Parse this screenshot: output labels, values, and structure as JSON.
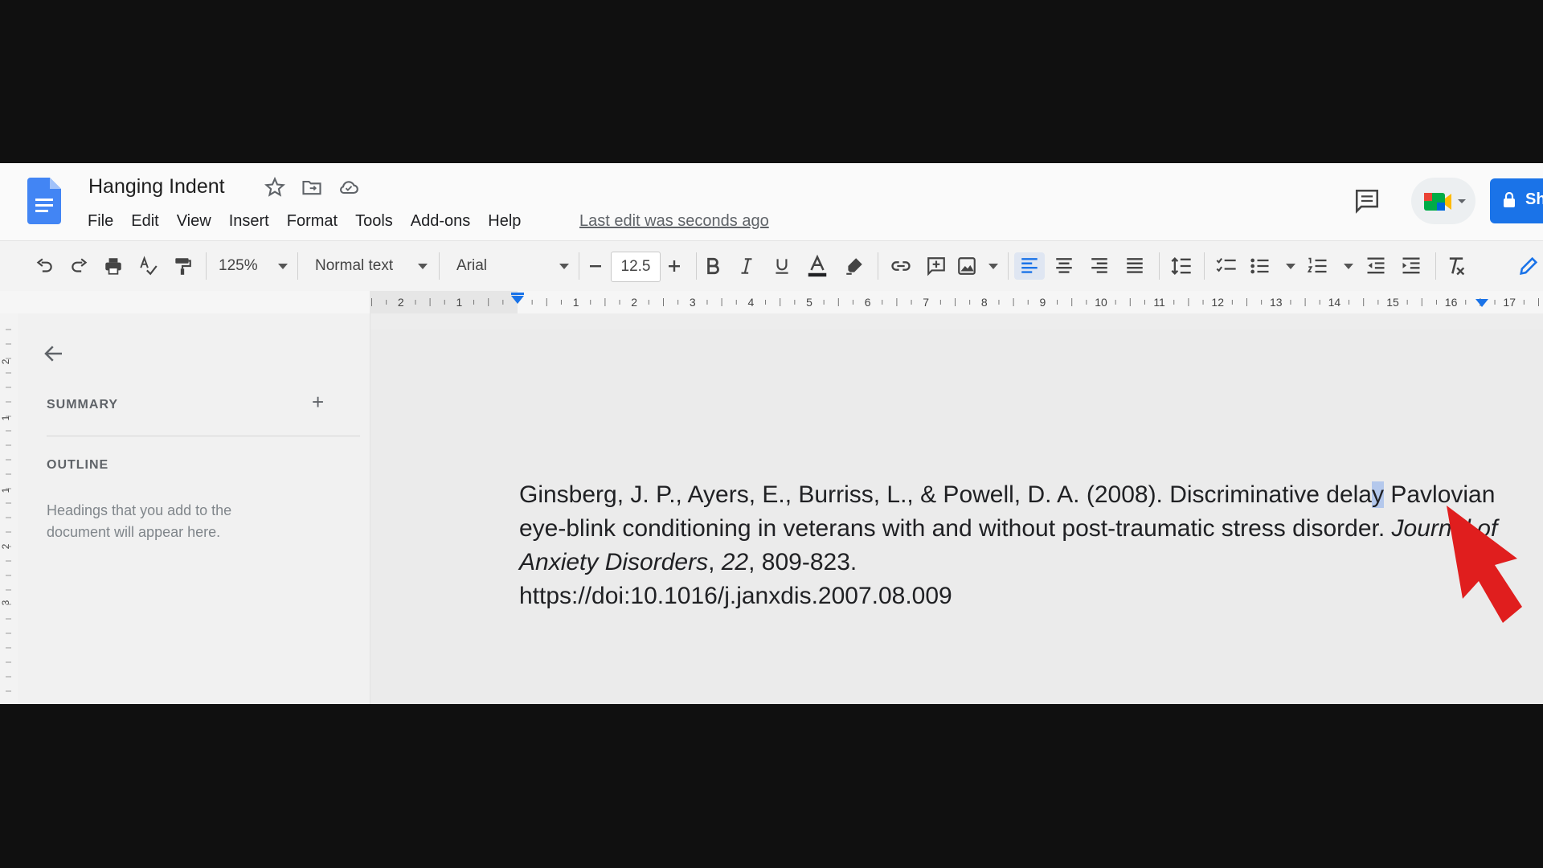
{
  "header": {
    "doc_title": "Hanging Indent",
    "menus": [
      "File",
      "Edit",
      "View",
      "Insert",
      "Format",
      "Tools",
      "Add-ons",
      "Help"
    ],
    "last_edit": "Last edit was seconds ago",
    "share_label": "Sh"
  },
  "toolbar": {
    "zoom": "125%",
    "style": "Normal text",
    "font": "Arial",
    "font_size": "12.5"
  },
  "ruler": {
    "left_numbers": [
      "2",
      "1"
    ],
    "right_numbers": [
      "1",
      "2",
      "3",
      "4",
      "5",
      "6",
      "7",
      "8",
      "9",
      "10",
      "11",
      "12",
      "13",
      "14",
      "15",
      "16",
      "17"
    ],
    "vertical_numbers": [
      "2",
      "1",
      "1",
      "2",
      "3"
    ]
  },
  "outline": {
    "summary_label": "SUMMARY",
    "add_symbol": "+",
    "outline_label": "OUTLINE",
    "hint": "Headings that you add to the document will appear here."
  },
  "document": {
    "citation_part1": "Ginsberg, J. P., Ayers, E., Burriss, L., & Powell, D. A. (2008). Discriminative dela",
    "citation_selected": "y",
    "citation_part2": "Pavlovian eye-blink conditioning in veterans with and without post-traumatic stress disorder. ",
    "journal": "Journal of Anxiety Disorders",
    "comma1": ", ",
    "volume": "22",
    "pages": ", 809-823.",
    "doi": "https://doi:10.1016/j.janxdis.2007.08.009"
  },
  "colors": {
    "accent": "#1a73e8",
    "selection": "#b4c8ec",
    "arrow": "#e01e1e"
  }
}
